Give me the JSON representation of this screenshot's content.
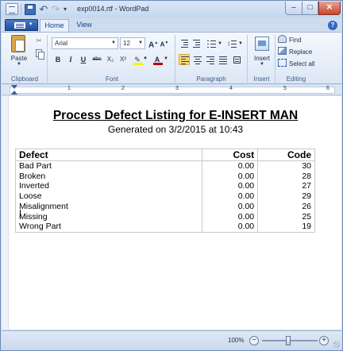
{
  "window": {
    "title": "exp0014.rtf - WordPad",
    "minimize_glyph": "–",
    "maximize_glyph": "□",
    "close_glyph": "✕"
  },
  "quick_access": {
    "icons": [
      "save-icon",
      "undo-icon",
      "redo-icon",
      "customize-dropdown-icon"
    ]
  },
  "tabs": [
    {
      "label": "Home",
      "active": true
    },
    {
      "label": "View",
      "active": false
    }
  ],
  "ribbon": {
    "clipboard": {
      "group_label": "Clipboard",
      "paste_label": "Paste"
    },
    "font": {
      "group_label": "Font",
      "font_name": "Arial",
      "font_size": "12",
      "bold": "B",
      "italic": "I",
      "underline": "U",
      "strikethrough": "abc",
      "subscript": "X₂",
      "superscript": "X²",
      "font_color_letter": "A",
      "grow_letter": "A",
      "shrink_letter": "A"
    },
    "paragraph": {
      "group_label": "Paragraph",
      "active_alignment": "left"
    },
    "insert": {
      "group_label": "Insert",
      "button_label": "Insert"
    },
    "editing": {
      "group_label": "Editing",
      "find": "Find",
      "replace": "Replace",
      "select_all": "Select all"
    }
  },
  "ruler": {
    "numbers": [
      "1",
      "2",
      "3",
      "4",
      "5",
      "6"
    ]
  },
  "document": {
    "title": "Process Defect Listing for E-INSERT MAN",
    "subtitle": "Generated on 3/2/2015 at 10:43",
    "table": {
      "headers": [
        "Defect",
        "Cost",
        "Code"
      ],
      "rows": [
        [
          "Bad Part",
          "0.00",
          "30"
        ],
        [
          "Broken",
          "0.00",
          "28"
        ],
        [
          "Inverted",
          "0.00",
          "27"
        ],
        [
          "Loose",
          "0.00",
          "29"
        ],
        [
          "Misalignment",
          "0.00",
          "26"
        ],
        [
          "Missing",
          "0.00",
          "25"
        ],
        [
          "Wrong Part",
          "0.00",
          "19"
        ]
      ]
    }
  },
  "statusbar": {
    "zoom": "100%",
    "zoom_out": "−",
    "zoom_in": "+"
  }
}
